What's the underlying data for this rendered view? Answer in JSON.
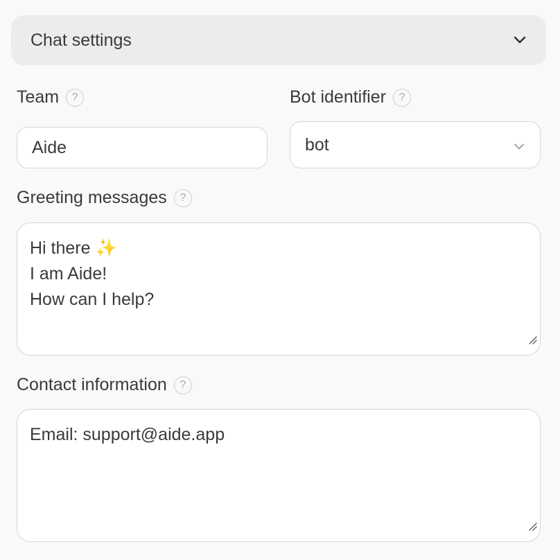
{
  "accordion": {
    "title": "Chat settings",
    "icon": "chevron-down-icon"
  },
  "team": {
    "label": "Team",
    "value": "Aide"
  },
  "bot": {
    "label": "Bot identifier",
    "value": "bot"
  },
  "greeting": {
    "label": "Greeting messages",
    "line1": "Hi there",
    "sparkle": "✨",
    "line2": "I am Aide!",
    "line3": "How can I help?"
  },
  "contact": {
    "label": "Contact information",
    "value": "Email: support@aide.app"
  },
  "help_glyph": "?"
}
